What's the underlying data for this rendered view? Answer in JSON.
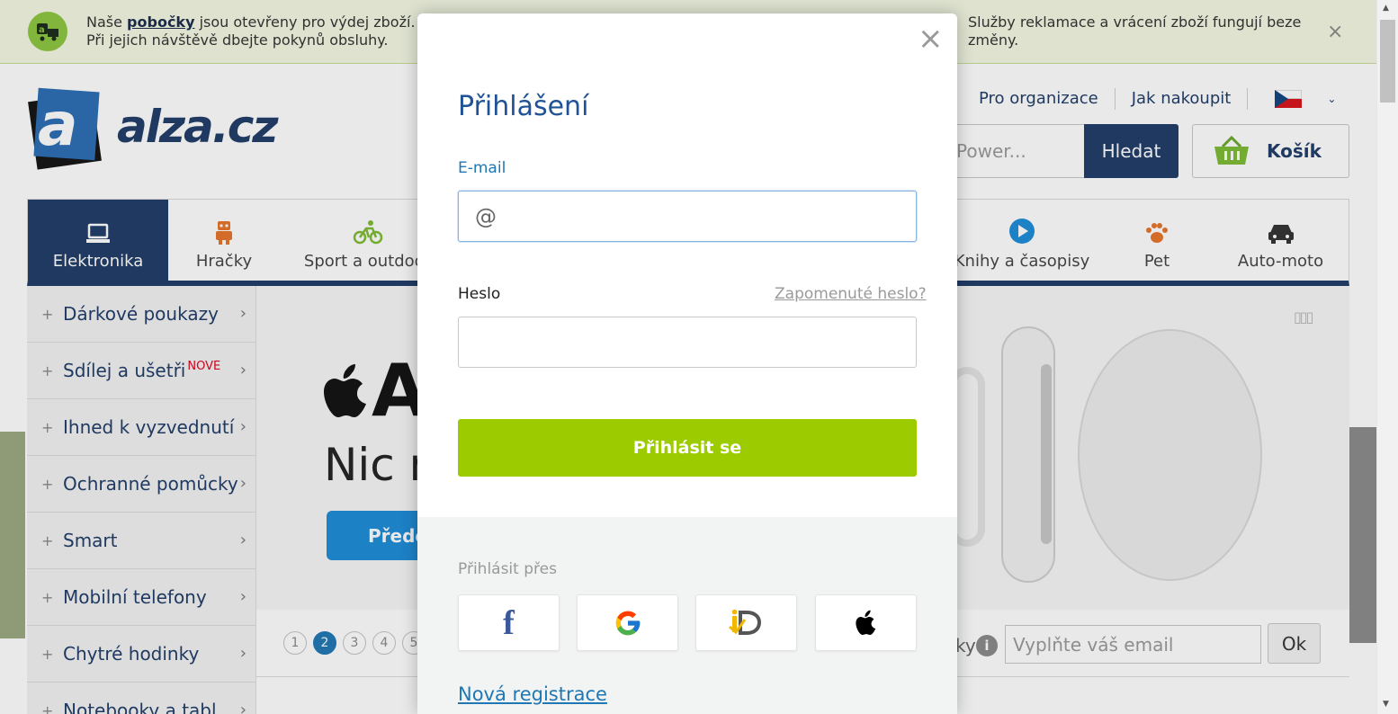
{
  "notice": {
    "text_before": "Naše ",
    "link": "pobočky",
    "text_after": " jsou otevřeny pro výdej zboží. Při jejich návštěvě dbejte pokynů obsluhy.",
    "right_text": "Služby reklamace a vrácení zboží fungují beze změny.",
    "close": "×"
  },
  "logo": {
    "letter": "a",
    "text": "alza.cz"
  },
  "header": {
    "links": [
      "Pro organizace",
      "Jak nakoupit"
    ],
    "language_caret": "⌄",
    "search_placeholder": "Power...",
    "search_button": "Hledat",
    "cart_label": "Košík"
  },
  "categories": [
    {
      "label": "Elektronika",
      "icon": "laptop-icon"
    },
    {
      "label": "Hračky",
      "icon": "robot-icon"
    },
    {
      "label": "Sport a outdoor",
      "icon": "bicycle-icon"
    },
    {
      "label": "Knihy a časopisy",
      "icon": "play-icon"
    },
    {
      "label": "Pet",
      "icon": "paw-icon"
    },
    {
      "label": "Auto-moto",
      "icon": "car-icon"
    }
  ],
  "sidebar": [
    {
      "label": "Dárkové poukazy",
      "badge": ""
    },
    {
      "label": "Sdílej a ušetři",
      "badge": "NOVÉ"
    },
    {
      "label": "Ihned k vyzvednutí",
      "badge": ""
    },
    {
      "label": "Ochranné pomůcky",
      "badge": ""
    },
    {
      "label": "Smart",
      "badge": ""
    },
    {
      "label": "Mobilní telefony",
      "badge": ""
    },
    {
      "label": "Chytré hodinky",
      "badge": ""
    },
    {
      "label": "Notebooky a tablety",
      "badge": ""
    }
  ],
  "banner": {
    "apple_text": "A",
    "tagline": "Nic n",
    "button": "Přede"
  },
  "pager": [
    "1",
    "2",
    "3",
    "4",
    "5"
  ],
  "newsletter": {
    "label": "ky",
    "placeholder": "Vyplňte váš email",
    "ok": "Ok",
    "info": "i"
  },
  "modal": {
    "close": "×",
    "title": "Přihlášení",
    "email_label": "E-mail",
    "email_prefix": "@",
    "password_label": "Heslo",
    "forgot_link": "Zapomenuté heslo?",
    "login_button": "Přihlásit se",
    "via_label": "Přihlásit přes",
    "providers": [
      "facebook",
      "google",
      "mojeid",
      "apple"
    ],
    "register_link": "Nová registrace"
  },
  "colors": {
    "brand_blue": "#1f3c68",
    "accent_green": "#9ccb00",
    "link_blue": "#1f77b4"
  }
}
